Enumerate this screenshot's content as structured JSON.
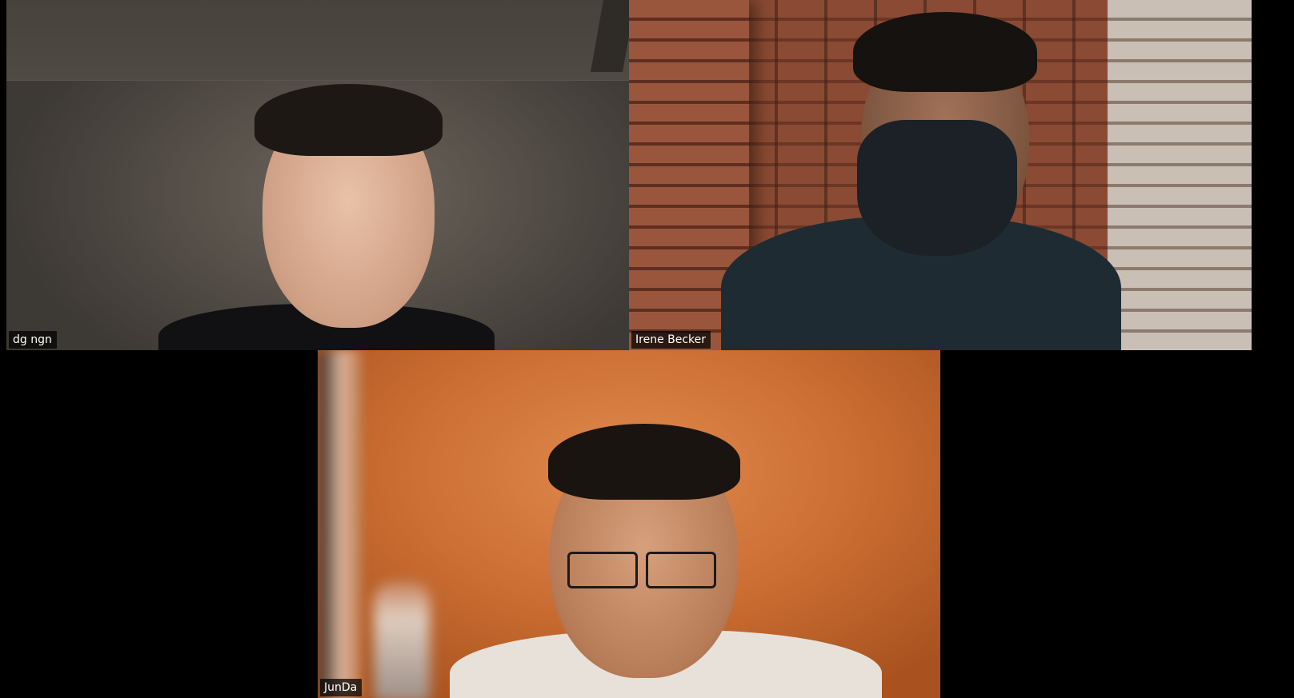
{
  "participants": [
    {
      "display_name": "dg ngn"
    },
    {
      "display_name": "Irene Becker"
    },
    {
      "display_name": "JunDa"
    }
  ]
}
